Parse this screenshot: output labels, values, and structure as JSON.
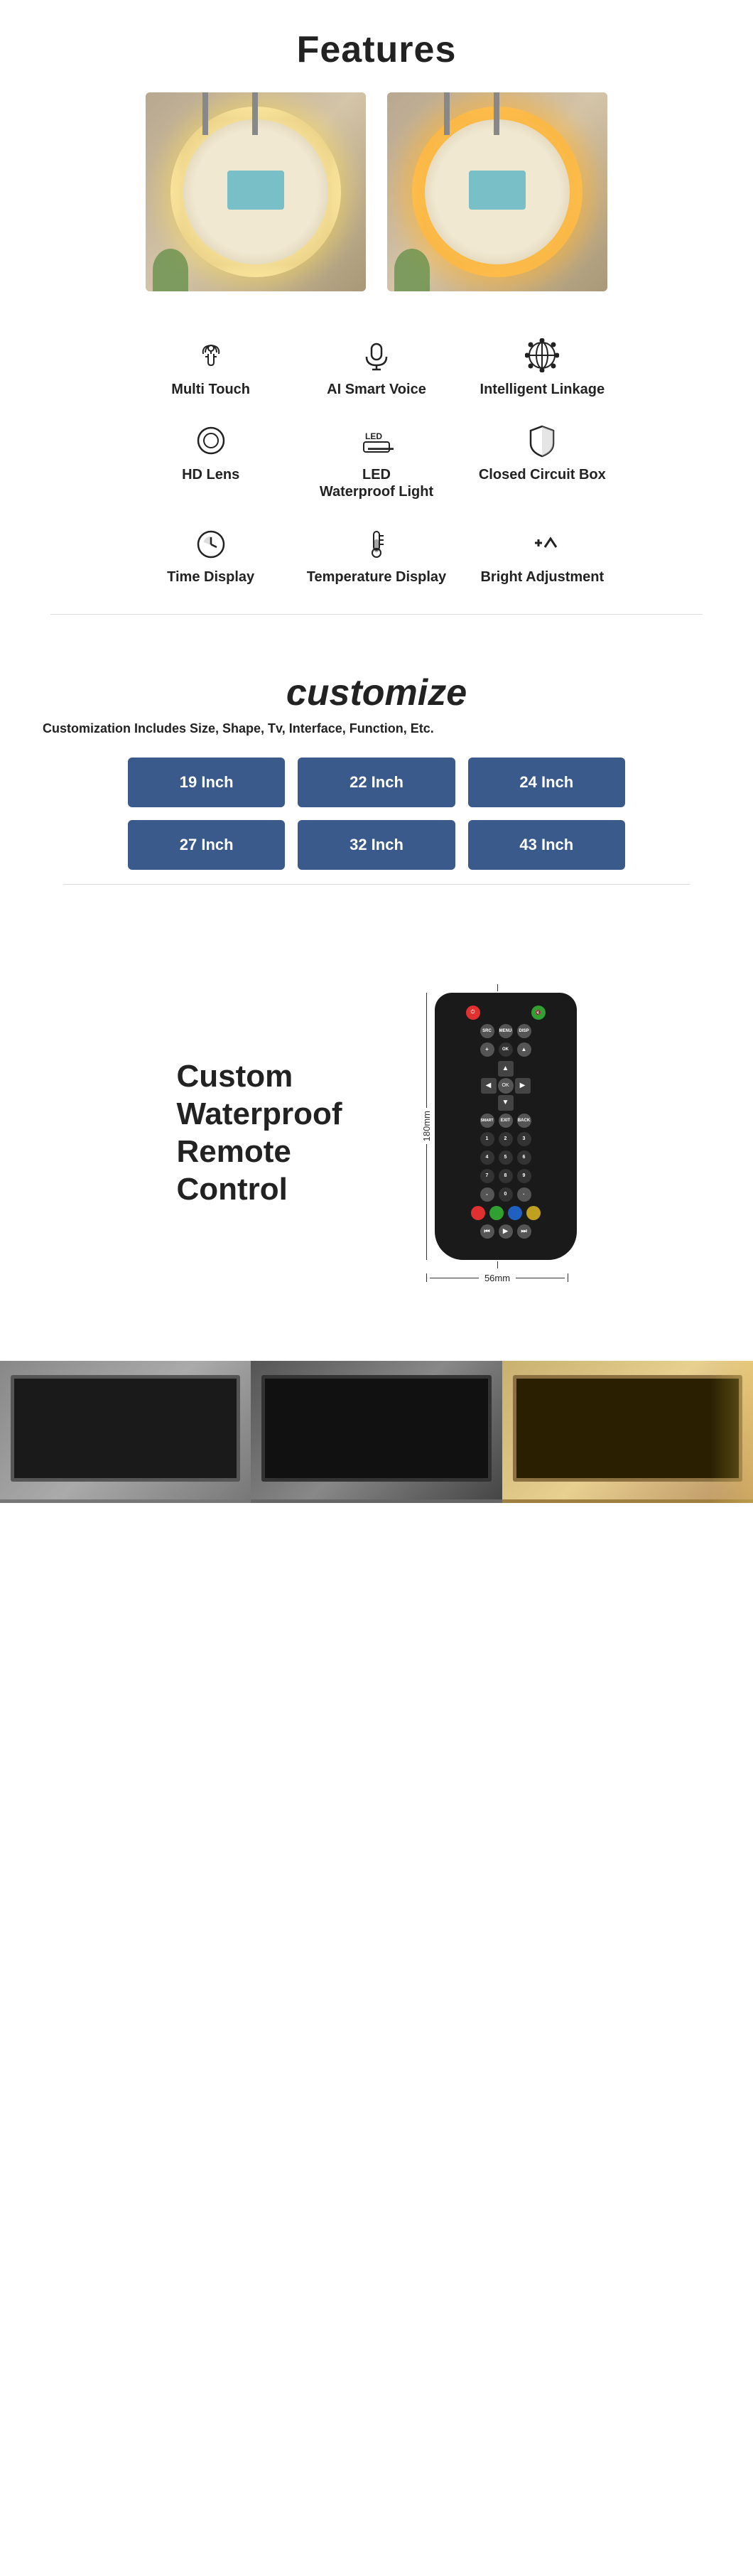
{
  "page": {
    "background": "#ffffff"
  },
  "features": {
    "title": "Features",
    "items": [
      {
        "id": "multi-touch",
        "label": "Multi Touch",
        "icon": "touch"
      },
      {
        "id": "ai-smart-voice",
        "label": "AI Smart Voice",
        "icon": "mic"
      },
      {
        "id": "intelligent-linkage",
        "label": "Intelligent Linkage",
        "icon": "globe-gear"
      },
      {
        "id": "hd-lens",
        "label": "HD Lens",
        "icon": "lens"
      },
      {
        "id": "led-waterproof-light",
        "label": "LED\nWaterproof Light",
        "icon": "led"
      },
      {
        "id": "closed-circuit-box",
        "label": "Closed Circuit Box",
        "icon": "shield"
      },
      {
        "id": "time-display",
        "label": "Time Display",
        "icon": "clock"
      },
      {
        "id": "temperature-display",
        "label": "Temperature Display",
        "icon": "thermometer"
      },
      {
        "id": "bright-adjustment",
        "label": "Bright Adjustment",
        "icon": "brightness"
      }
    ]
  },
  "customize": {
    "title": "customize",
    "subtitle": "Customization Includes Size, Shape, Tv, Interface, Function, Etc.",
    "sizes": [
      "19 Inch",
      "22 Inch",
      "24 Inch",
      "27 Inch",
      "32 Inch",
      "43 Inch"
    ]
  },
  "remote": {
    "title": "Custom Waterproof Remote Control",
    "height_label": "180mm",
    "width_label": "56mm"
  },
  "images": {
    "mirror_left_alt": "Round mirror with warm white backlight in bathroom",
    "mirror_right_alt": "Round mirror with golden backlight in bathroom",
    "bottom_1_alt": "Smart mirror TV product photo 1",
    "bottom_2_alt": "Smart mirror TV product photo 2",
    "bottom_3_alt": "Smart mirror TV product photo 3"
  }
}
